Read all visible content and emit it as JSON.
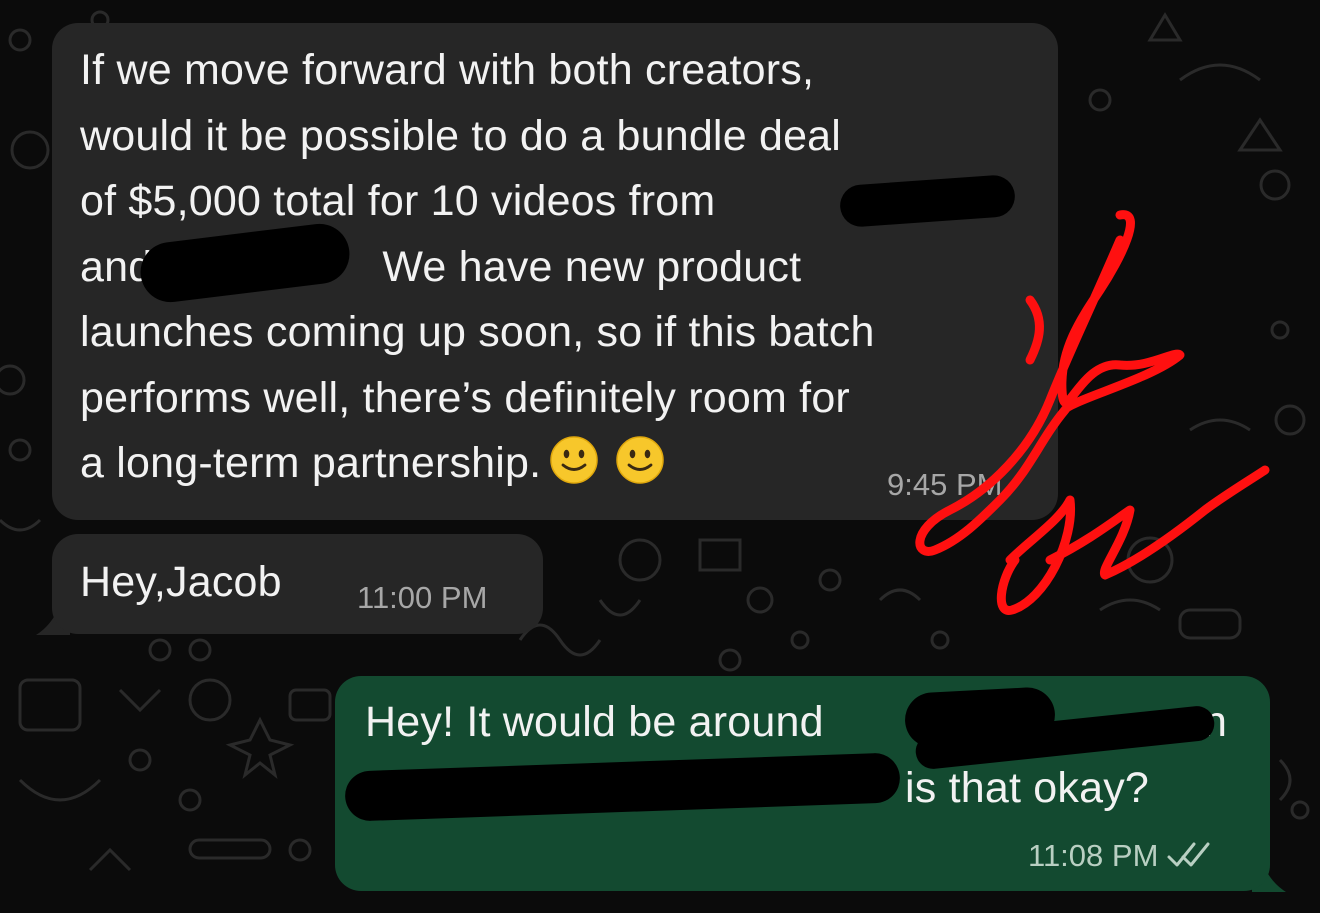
{
  "messages": [
    {
      "direction": "incoming",
      "lines": [
        "If we move forward with both creators,",
        "would it be possible to do a bundle deal",
        "of $5,000 total for 10 videos from",
        "and",
        "We have new product",
        "launches coming up soon, so if this batch",
        "performs well, there’s definitely room for",
        "a long-term partnership."
      ],
      "emoji": [
        "slightly-smiling-face-icon",
        "slightly-smiling-face-icon"
      ],
      "time": "9:45 PM"
    },
    {
      "direction": "incoming",
      "text": "Hey,Jacob",
      "time": "11:00 PM"
    },
    {
      "direction": "outgoing",
      "line1_start": "Hey! It would be around",
      "line1_end": "n",
      "line2_end": "is that okay?",
      "time": "11:08 PM",
      "status_icon": "double-check-read-icon"
    }
  ],
  "colors": {
    "incoming_bubble": "#262626",
    "outgoing_bubble": "#134a30",
    "background": "#0b0b0b",
    "scribble": "#ff1010"
  }
}
